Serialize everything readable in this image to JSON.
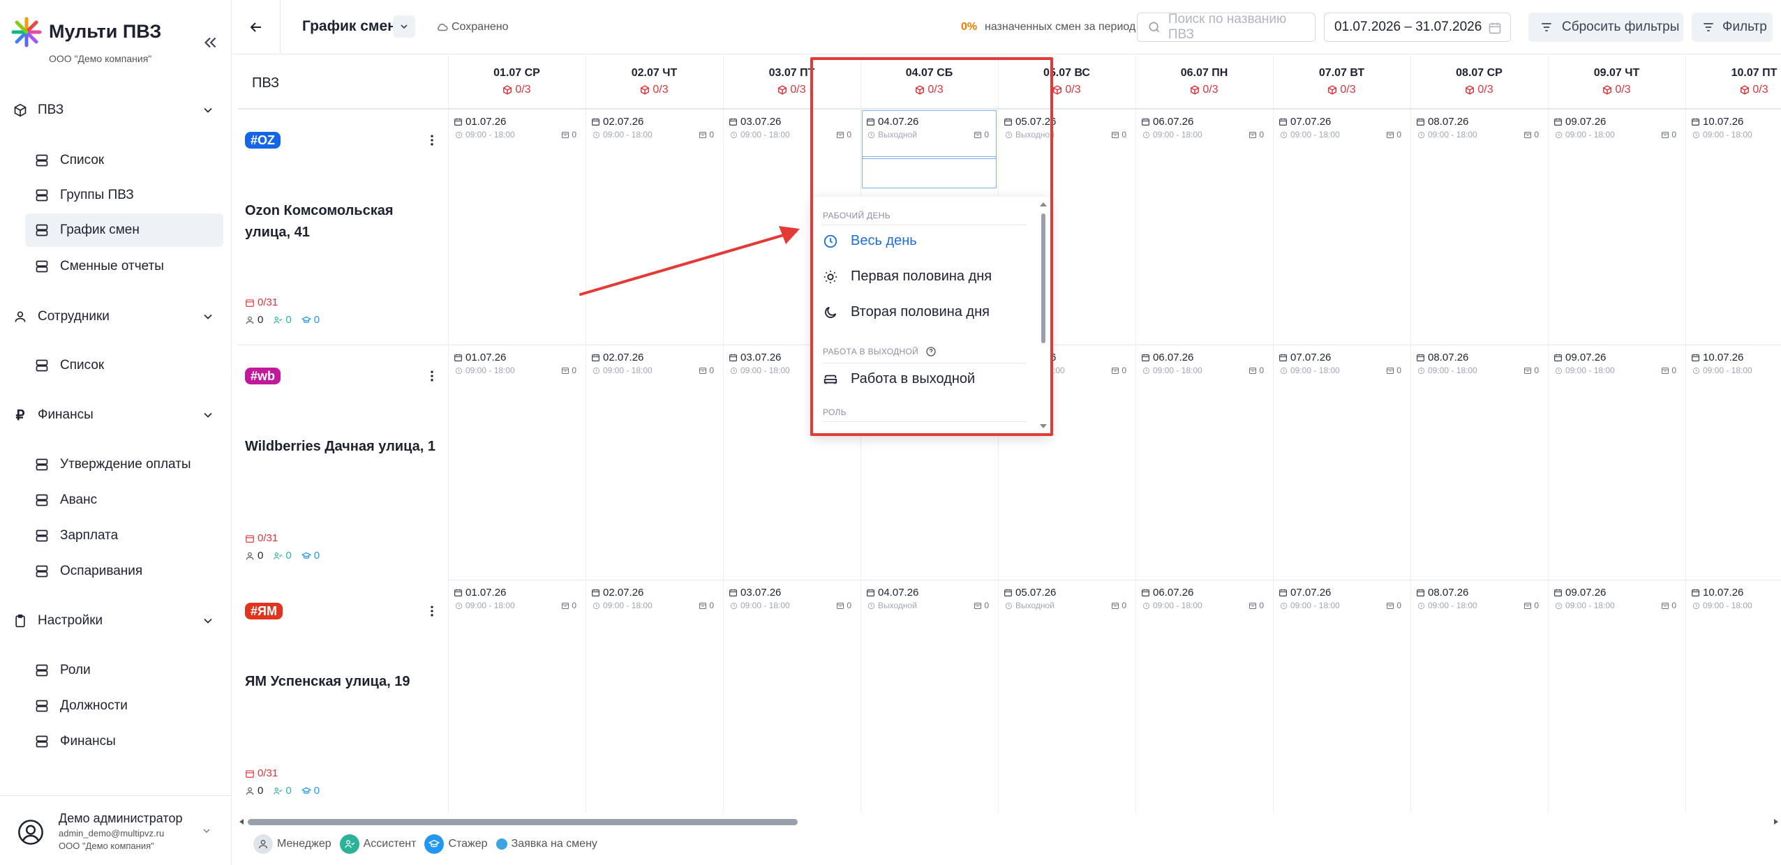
{
  "app": {
    "title": "Мульти ПВЗ",
    "company": "ООО \"Демо компания\""
  },
  "sidebar": {
    "sections": [
      {
        "label": "ПВЗ",
        "icon": "box-icon",
        "items": [
          "Список",
          "Группы ПВЗ",
          "График смен",
          "Сменные отчеты"
        ]
      },
      {
        "label": "Сотрудники",
        "icon": "person-icon",
        "items": [
          "Список"
        ]
      },
      {
        "label": "Финансы",
        "icon": "ruble-icon",
        "items": [
          "Утверждение оплаты",
          "Аванс",
          "Зарплата",
          "Оспаривания"
        ]
      },
      {
        "label": "Настройки",
        "icon": "clipboard-icon",
        "items": [
          "Роли",
          "Должности",
          "Финансы"
        ]
      }
    ],
    "active_item": "График смен"
  },
  "user": {
    "name": "Демо администратор",
    "email": "admin_demo@multipvz.ru",
    "company": "ООО \"Демо компания\""
  },
  "topbar": {
    "title": "График смен",
    "saved": "Сохранено",
    "percent": "0%",
    "percent_label": "назначенных смен за период",
    "search_placeholder": "Поиск по названию ПВЗ",
    "date_range": "01.07.2026 – 31.07.2026",
    "reset_filters": "Сбросить фильтры",
    "filter": "Фильтр"
  },
  "grid": {
    "pvz_header": "ПВЗ",
    "days": [
      {
        "header": "01.07 СР",
        "count": "0/3",
        "date": "01.07.26"
      },
      {
        "header": "02.07 ЧТ",
        "count": "0/3",
        "date": "02.07.26"
      },
      {
        "header": "03.07 ПТ",
        "count": "0/3",
        "date": "03.07.26"
      },
      {
        "header": "04.07 СБ",
        "count": "0/3",
        "date": "04.07.26"
      },
      {
        "header": "05.07 ВС",
        "count": "0/3",
        "date": "05.07.26"
      },
      {
        "header": "06.07 ПН",
        "count": "0/3",
        "date": "06.07.26"
      },
      {
        "header": "07.07 ВТ",
        "count": "0/3",
        "date": "07.07.26"
      },
      {
        "header": "08.07 СР",
        "count": "0/3",
        "date": "08.07.26"
      },
      {
        "header": "09.07 ЧТ",
        "count": "0/3",
        "date": "09.07.26"
      },
      {
        "header": "10.07 ПТ",
        "count": "0/3",
        "date": "10.07.26"
      }
    ],
    "work_time": "09:00 - 18:00",
    "day_off": "Выходной",
    "slot_count": "0",
    "pvz": [
      {
        "badge": "#OZ",
        "color": "#1565e8",
        "name": "Ozon Комсомольская улица, 41",
        "shifts": "0/31",
        "managers": "0",
        "assistants": "0",
        "interns": "0"
      },
      {
        "badge": "#wb",
        "color": "#c2189b",
        "name": "Wildberries Дачная улица, 1",
        "shifts": "0/31",
        "managers": "0",
        "assistants": "0",
        "interns": "0"
      },
      {
        "badge": "#ЯМ",
        "color": "#e0341e",
        "name": "ЯМ Успенская улица, 19",
        "shifts": "0/31",
        "managers": "0",
        "assistants": "0",
        "interns": "0"
      }
    ]
  },
  "dropdown": {
    "section1": "РАБОЧИЙ ДЕНЬ",
    "item_full": "Весь день",
    "item_first": "Первая половина дня",
    "item_second": "Вторая половина дня",
    "section2": "РАБОТА В ВЫХОДНОЙ",
    "item_weekend": "Работа в выходной",
    "section3": "РОЛЬ"
  },
  "legend": {
    "manager": "Менеджер",
    "assistant": "Ассистент",
    "intern": "Стажер",
    "request": "Заявка на смену"
  },
  "colors": {
    "accent": "#1e6fd9",
    "danger": "#e0343a",
    "highlight": "#e53935",
    "teal": "#2bb39a"
  }
}
